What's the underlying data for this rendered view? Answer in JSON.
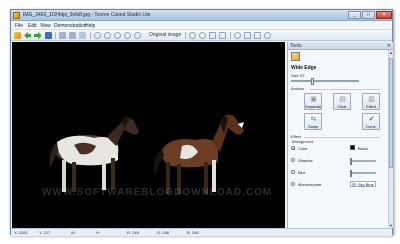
{
  "window": {
    "title": "IMG_3460_1024dpi_9x6df.jpg - Teorex Cutout Studio Lite",
    "minimize": "_",
    "maximize": "□",
    "close": "✕"
  },
  "menu": [
    "File",
    "Edit",
    "View",
    "Demonstration",
    "Help"
  ],
  "toolbar": {
    "zoom_label": "Original image",
    "icons": [
      "open-icon",
      "back-arrow-icon",
      "forward-arrow-icon",
      "save-icon",
      "cut-icon",
      "copy-icon",
      "paste-icon",
      "zoom-in-icon",
      "zoom-out-icon",
      "zoom-fit-icon",
      "rotate-left-icon",
      "rotate-right-icon",
      "flip-icon",
      "undo-icon",
      "redo-icon",
      "settings-icon",
      "help-icon"
    ]
  },
  "canvas": {
    "watermark": "WWW.SOFTWAREBLOGDOWNLOAD.COM"
  },
  "status": [
    {
      "label": "X:",
      "value": "2281"
    },
    {
      "label": "Y:",
      "value": "217"
    },
    {
      "label": "W:",
      "value": ""
    },
    {
      "label": "H:",
      "value": ""
    },
    {
      "label": "R:",
      "value": "248"
    },
    {
      "label": "G:",
      "value": "248"
    },
    {
      "label": "B:",
      "value": "248"
    }
  ],
  "tools": {
    "title": "Tools",
    "close": "✕",
    "selected_tool": "Wide Edge",
    "size_label": "Size 20",
    "size_value": 0.3,
    "actions_label": "Actions",
    "actions": [
      {
        "label": "Separate",
        "icon": "separate-icon"
      },
      {
        "label": "Clear",
        "icon": "clear-icon"
      },
      {
        "label": "Effect",
        "icon": "effect-icon"
      },
      {
        "label": "Swap",
        "icon": "swap-icon"
      },
      {
        "label": "Done",
        "icon": "done-icon"
      }
    ],
    "effect_label": "Effect",
    "background_label": "Background",
    "options": [
      {
        "label": "Color",
        "checked": true,
        "swatch": "#000000",
        "value": "Black"
      },
      {
        "label": "Shadow",
        "checked": false
      },
      {
        "label": "Blur",
        "checked": false
      },
      {
        "label": "Monochrome",
        "checked": false,
        "swatch": "#9fc3ea",
        "value": "Sky Blue"
      }
    ]
  },
  "colors": {
    "accent": "#2a63b8",
    "done_check": "#2aa02a",
    "swap_arrows": "#2a7fd6"
  }
}
